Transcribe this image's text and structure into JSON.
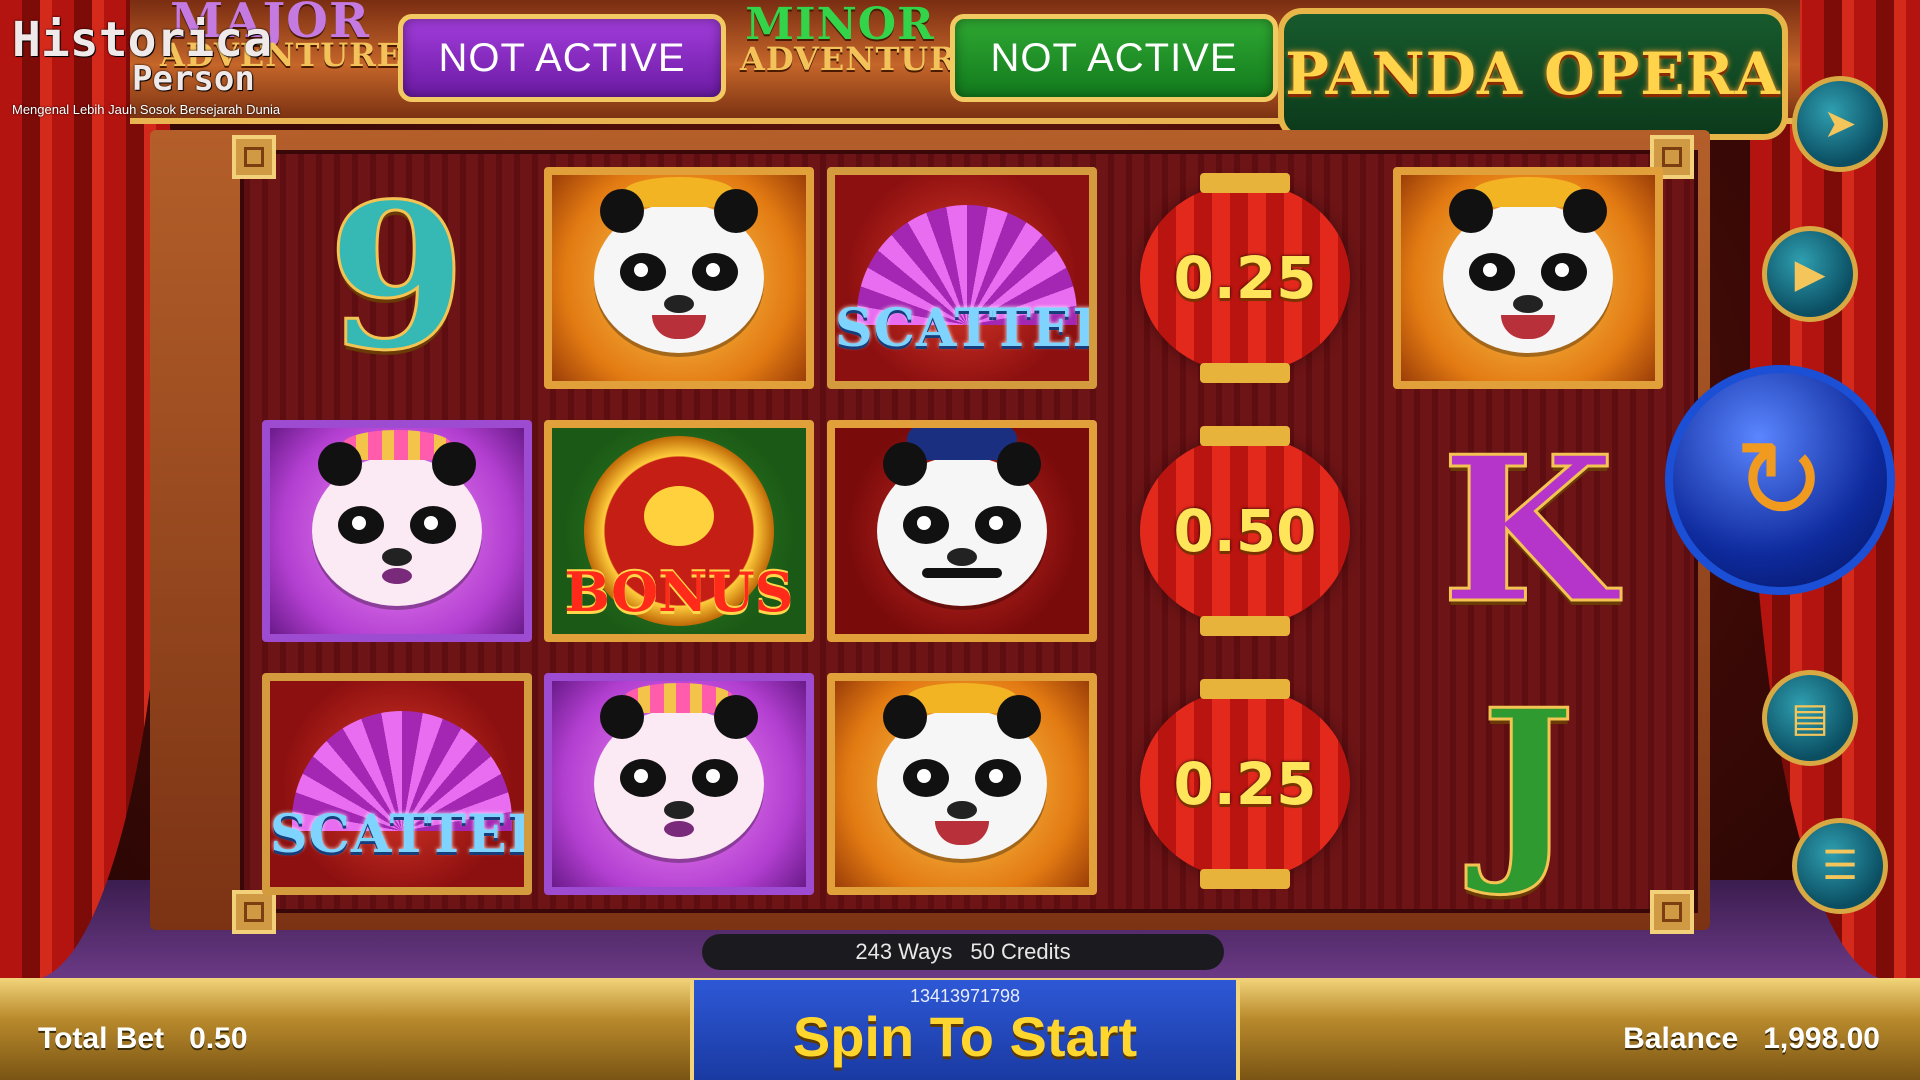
{
  "watermark": {
    "line1": "Historica",
    "line2": "Person",
    "tagline": "Mengenal Lebih Jauh Sosok Bersejarah Dunia"
  },
  "jackpots": {
    "major": {
      "line1": "MAJOR",
      "line2": "ADVENTURE",
      "status": "NOT ACTIVE"
    },
    "minor": {
      "line1": "MINOR",
      "line2": "ADVENTURE",
      "status": "NOT ACTIVE"
    }
  },
  "game_title": "PANDA OPERA",
  "reels": {
    "symbols": [
      [
        "nine",
        "panda-gold",
        "scatter",
        "lantern",
        "panda-gold"
      ],
      [
        "panda-lady",
        "bonus",
        "panda-officer",
        "lantern",
        "king"
      ],
      [
        "scatter",
        "panda-lady",
        "panda-gold",
        "lantern",
        "jack"
      ]
    ],
    "glyphs": {
      "nine": "9",
      "king": "K",
      "jack": "J"
    },
    "scatter_label": "SCATTER",
    "bonus_label": "BONUS",
    "lantern_values": [
      "0.25",
      "0.50",
      "0.25"
    ]
  },
  "controls": {
    "turbo": "turbo-icon",
    "autoplay": "autoplay-icon",
    "spin": "spin-icon",
    "bet": "coins-icon",
    "menu": "menu-icon"
  },
  "info": {
    "ways": "243 Ways",
    "credits": "50 Credits"
  },
  "bottom": {
    "total_bet_label": "Total Bet",
    "total_bet_value": "0.50",
    "spin_id": "13413971798",
    "spin_label": "Spin To Start",
    "balance_label": "Balance",
    "balance_value": "1,998.00"
  },
  "colors": {
    "major_box": "#a23ddb",
    "minor_box": "#2fa832",
    "spin_bar": "#2d58d6",
    "accent_gold": "#ffd62e"
  }
}
